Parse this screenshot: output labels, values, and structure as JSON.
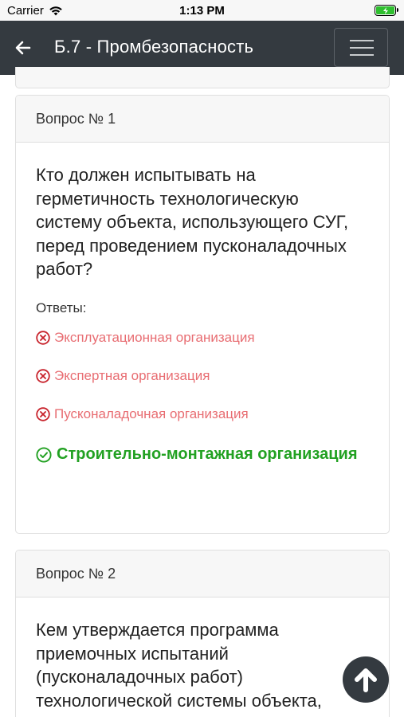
{
  "status_bar": {
    "carrier": "Carrier",
    "time": "1:13 PM"
  },
  "navbar": {
    "title": "Б.7 - Промбезопасность"
  },
  "questions": [
    {
      "header": "Вопрос № 1",
      "text": "Кто должен испытывать на герметичность технологическую систему объекта, использующего СУГ, перед проведением пусконаладочных работ?",
      "answers_label": "Ответы:",
      "answers": [
        {
          "text": "Эксплуатационная организация",
          "status": "wrong"
        },
        {
          "text": "Экспертная организация",
          "status": "wrong"
        },
        {
          "text": "Пусконаладочная организация",
          "status": "wrong"
        },
        {
          "text": "Строительно-монтажная организация",
          "status": "correct"
        }
      ]
    },
    {
      "header": "Вопрос № 2",
      "text": "Кем утверждается программа приемочных испытаний (пусконаладочных работ) технологической системы объекта, использующего СУГ?"
    }
  ],
  "colors": {
    "navbar": "#343a40",
    "wrong": "#e86d72",
    "correct": "#22a122"
  },
  "icons": {
    "back": "arrow-left-icon",
    "menu": "hamburger-icon",
    "wrong": "x-circle-icon",
    "correct": "check-circle-icon",
    "scroll_top": "arrow-up-icon"
  }
}
